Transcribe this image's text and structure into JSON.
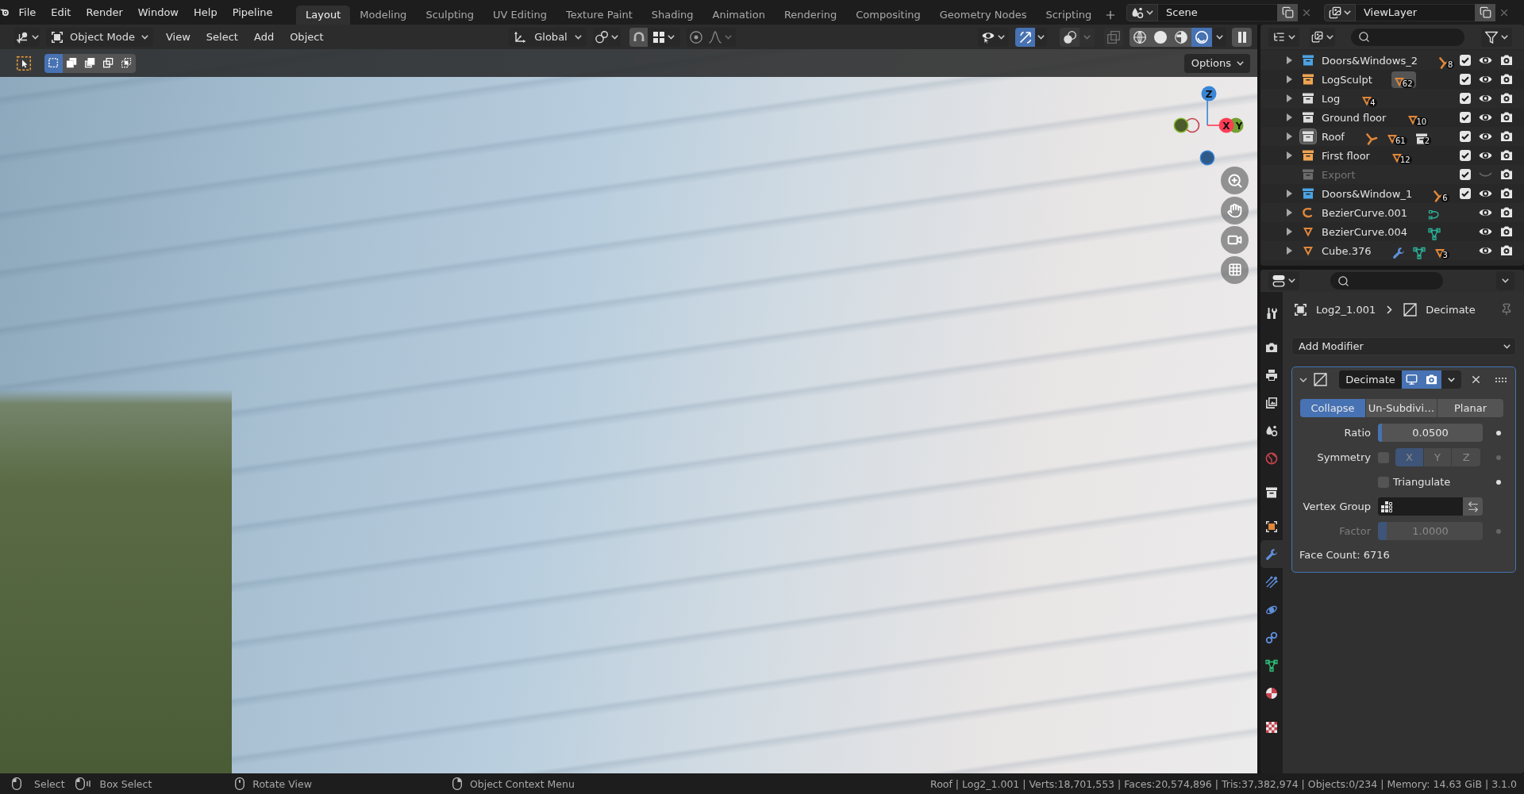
{
  "top_bar": {
    "menus": [
      "File",
      "Edit",
      "Render",
      "Window",
      "Help",
      "Pipeline"
    ],
    "workspaces": [
      {
        "label": "Layout",
        "selected": true
      },
      {
        "label": "Modeling",
        "selected": false
      },
      {
        "label": "Sculpting",
        "selected": false
      },
      {
        "label": "UV Editing",
        "selected": false
      },
      {
        "label": "Texture Paint",
        "selected": false
      },
      {
        "label": "Shading",
        "selected": false
      },
      {
        "label": "Animation",
        "selected": false
      },
      {
        "label": "Rendering",
        "selected": false
      },
      {
        "label": "Compositing",
        "selected": false
      },
      {
        "label": "Geometry Nodes",
        "selected": false
      },
      {
        "label": "Scripting",
        "selected": false
      }
    ],
    "scene": "Scene",
    "view_layer": "ViewLayer"
  },
  "viewport": {
    "header": {
      "mode": "Object Mode",
      "menus": [
        "View",
        "Select",
        "Add",
        "Object"
      ],
      "orientation": "Global",
      "gizmos_on": true,
      "overlays_on": false,
      "xray_on": false,
      "shading": [
        {
          "kind": "wireframe",
          "selected": false
        },
        {
          "kind": "solid",
          "selected": false
        },
        {
          "kind": "material",
          "selected": false
        },
        {
          "kind": "rendered",
          "selected": true
        }
      ]
    },
    "select_modes": [
      {
        "kind": "set",
        "selected": true
      },
      {
        "kind": "extend",
        "selected": false
      },
      {
        "kind": "subtract",
        "selected": false
      },
      {
        "kind": "invert",
        "selected": false
      },
      {
        "kind": "intersect",
        "selected": false
      }
    ],
    "options": "Options",
    "axes": {
      "z": "Z",
      "x": "X",
      "y": "Y"
    }
  },
  "outliner": {
    "rows": [
      {
        "name": "Doors&Windows_2",
        "kind": "collection",
        "color": "#4ba3e3",
        "expandable": true,
        "expanded": false,
        "active": false,
        "excluded": false,
        "checked": true,
        "visible": true,
        "contents": [
          {
            "kind": "armature",
            "count": "8",
            "active": false
          }
        ]
      },
      {
        "name": "LogSculpt",
        "kind": "collection",
        "color": "#f0a452",
        "expandable": true,
        "expanded": false,
        "active": false,
        "excluded": false,
        "checked": true,
        "visible": true,
        "contents": [
          {
            "kind": "mesh",
            "count": "62",
            "active": true
          }
        ]
      },
      {
        "name": "Log",
        "kind": "collection",
        "color": "#dcdcdc",
        "expandable": true,
        "expanded": false,
        "active": false,
        "excluded": false,
        "checked": true,
        "visible": true,
        "contents": [
          {
            "kind": "mesh",
            "count": "4",
            "active": false
          }
        ]
      },
      {
        "name": "Ground floor",
        "kind": "collection",
        "color": "#dcdcdc",
        "expandable": true,
        "expanded": false,
        "active": false,
        "excluded": false,
        "checked": true,
        "visible": true,
        "contents": [
          {
            "kind": "mesh",
            "count": "10",
            "active": false
          }
        ]
      },
      {
        "name": "Roof",
        "kind": "collection",
        "color": "#dcdcdc",
        "expandable": true,
        "expanded": false,
        "active": true,
        "excluded": false,
        "checked": true,
        "visible": true,
        "contents": [
          {
            "kind": "armature",
            "active": false
          },
          {
            "kind": "mesh",
            "count": "61",
            "active": false
          },
          {
            "kind": "collection",
            "count": "2",
            "active": false
          }
        ]
      },
      {
        "name": "First floor",
        "kind": "collection",
        "color": "#f0a452",
        "expandable": true,
        "expanded": false,
        "active": false,
        "excluded": false,
        "checked": true,
        "visible": true,
        "contents": [
          {
            "kind": "mesh",
            "count": "12",
            "active": false
          }
        ]
      },
      {
        "name": "Export",
        "kind": "collection",
        "color": "#6c6c6c",
        "expandable": false,
        "active": false,
        "excluded": true,
        "checked": true,
        "visible": false
      },
      {
        "name": "Doors&Window_1",
        "kind": "collection",
        "color": "#4ba3e3",
        "expandable": true,
        "expanded": false,
        "active": false,
        "excluded": false,
        "checked": true,
        "visible": true,
        "contents": [
          {
            "kind": "armature",
            "count": "6",
            "active": false
          }
        ]
      },
      {
        "name": "BezierCurve.001",
        "kind": "curve",
        "expandable": true,
        "expanded": false,
        "active": false,
        "excluded": false,
        "visible": true,
        "contents": [
          {
            "kind": "curve_data",
            "active": false
          }
        ]
      },
      {
        "name": "BezierCurve.004",
        "kind": "mesh",
        "expandable": true,
        "expanded": false,
        "active": false,
        "excluded": false,
        "visible": true,
        "contents": [
          {
            "kind": "mesh_data",
            "active": false
          }
        ]
      },
      {
        "name": "Cube.376",
        "kind": "mesh",
        "expandable": true,
        "expanded": false,
        "active": false,
        "excluded": false,
        "visible": true,
        "contents": [
          {
            "kind": "modifier",
            "active": false
          },
          {
            "kind": "mesh_data",
            "active": false
          },
          {
            "kind": "mesh",
            "count": "3",
            "active": false
          }
        ]
      }
    ]
  },
  "properties": {
    "tabs": [
      {
        "kind": "tool",
        "selected": false
      },
      {
        "kind": "render",
        "selected": false
      },
      {
        "kind": "output",
        "selected": false
      },
      {
        "kind": "view_layer",
        "selected": false
      },
      {
        "kind": "scene",
        "selected": false
      },
      {
        "kind": "world",
        "selected": false
      },
      {
        "kind": "collection",
        "selected": false
      },
      {
        "kind": "object",
        "selected": false
      },
      {
        "kind": "modifiers",
        "selected": true
      },
      {
        "kind": "particles",
        "selected": false
      },
      {
        "kind": "physics",
        "selected": false
      },
      {
        "kind": "constraints",
        "selected": false
      },
      {
        "kind": "data",
        "selected": false
      },
      {
        "kind": "material",
        "selected": false
      },
      {
        "kind": "texture",
        "selected": false
      }
    ],
    "object": "Log2_1.001",
    "modifier_crumb": "Decimate",
    "add_modifier": "Add Modifier",
    "modifier": {
      "name": "Decimate",
      "expanded": true,
      "show_viewport": true,
      "show_render": true,
      "modes": [
        {
          "label": "Collapse",
          "selected": true
        },
        {
          "label": "Un-Subdivi…",
          "selected": false
        },
        {
          "label": "Planar",
          "selected": false
        }
      ],
      "fields": [
        {
          "kind": "slider",
          "label": "Ratio",
          "value": "0.0500",
          "level": 0.04,
          "disabled": false
        },
        {
          "kind": "axes",
          "label": "Symmetry",
          "checked": false,
          "axes": [
            {
              "label": "X",
              "selected": true
            },
            {
              "label": "Y",
              "selected": false
            },
            {
              "label": "Z",
              "selected": false
            }
          ]
        },
        {
          "kind": "checkbox",
          "label": "Triangulate",
          "checked": false
        },
        {
          "kind": "group",
          "label": "Vertex Group"
        },
        {
          "kind": "slider",
          "label": "Factor",
          "value": "1.0000",
          "level": 0.08,
          "disabled": true
        }
      ],
      "face_count": "Face Count: 6716"
    }
  },
  "status_bar": {
    "hints": [
      {
        "kind": "left_click",
        "label": "Select"
      },
      {
        "kind": "left_drag",
        "label": "Box Select"
      },
      {
        "kind": "middle_drag",
        "label": "Rotate View"
      },
      {
        "kind": "right_click",
        "label": "Object Context Menu"
      }
    ],
    "stats": "Roof | Log2_1.001 | Verts:18,701,553 | Faces:20,574,896 | Tris:37,382,974 | Objects:0/234 | Memory: 14.63 GiB | 3.1.0"
  }
}
